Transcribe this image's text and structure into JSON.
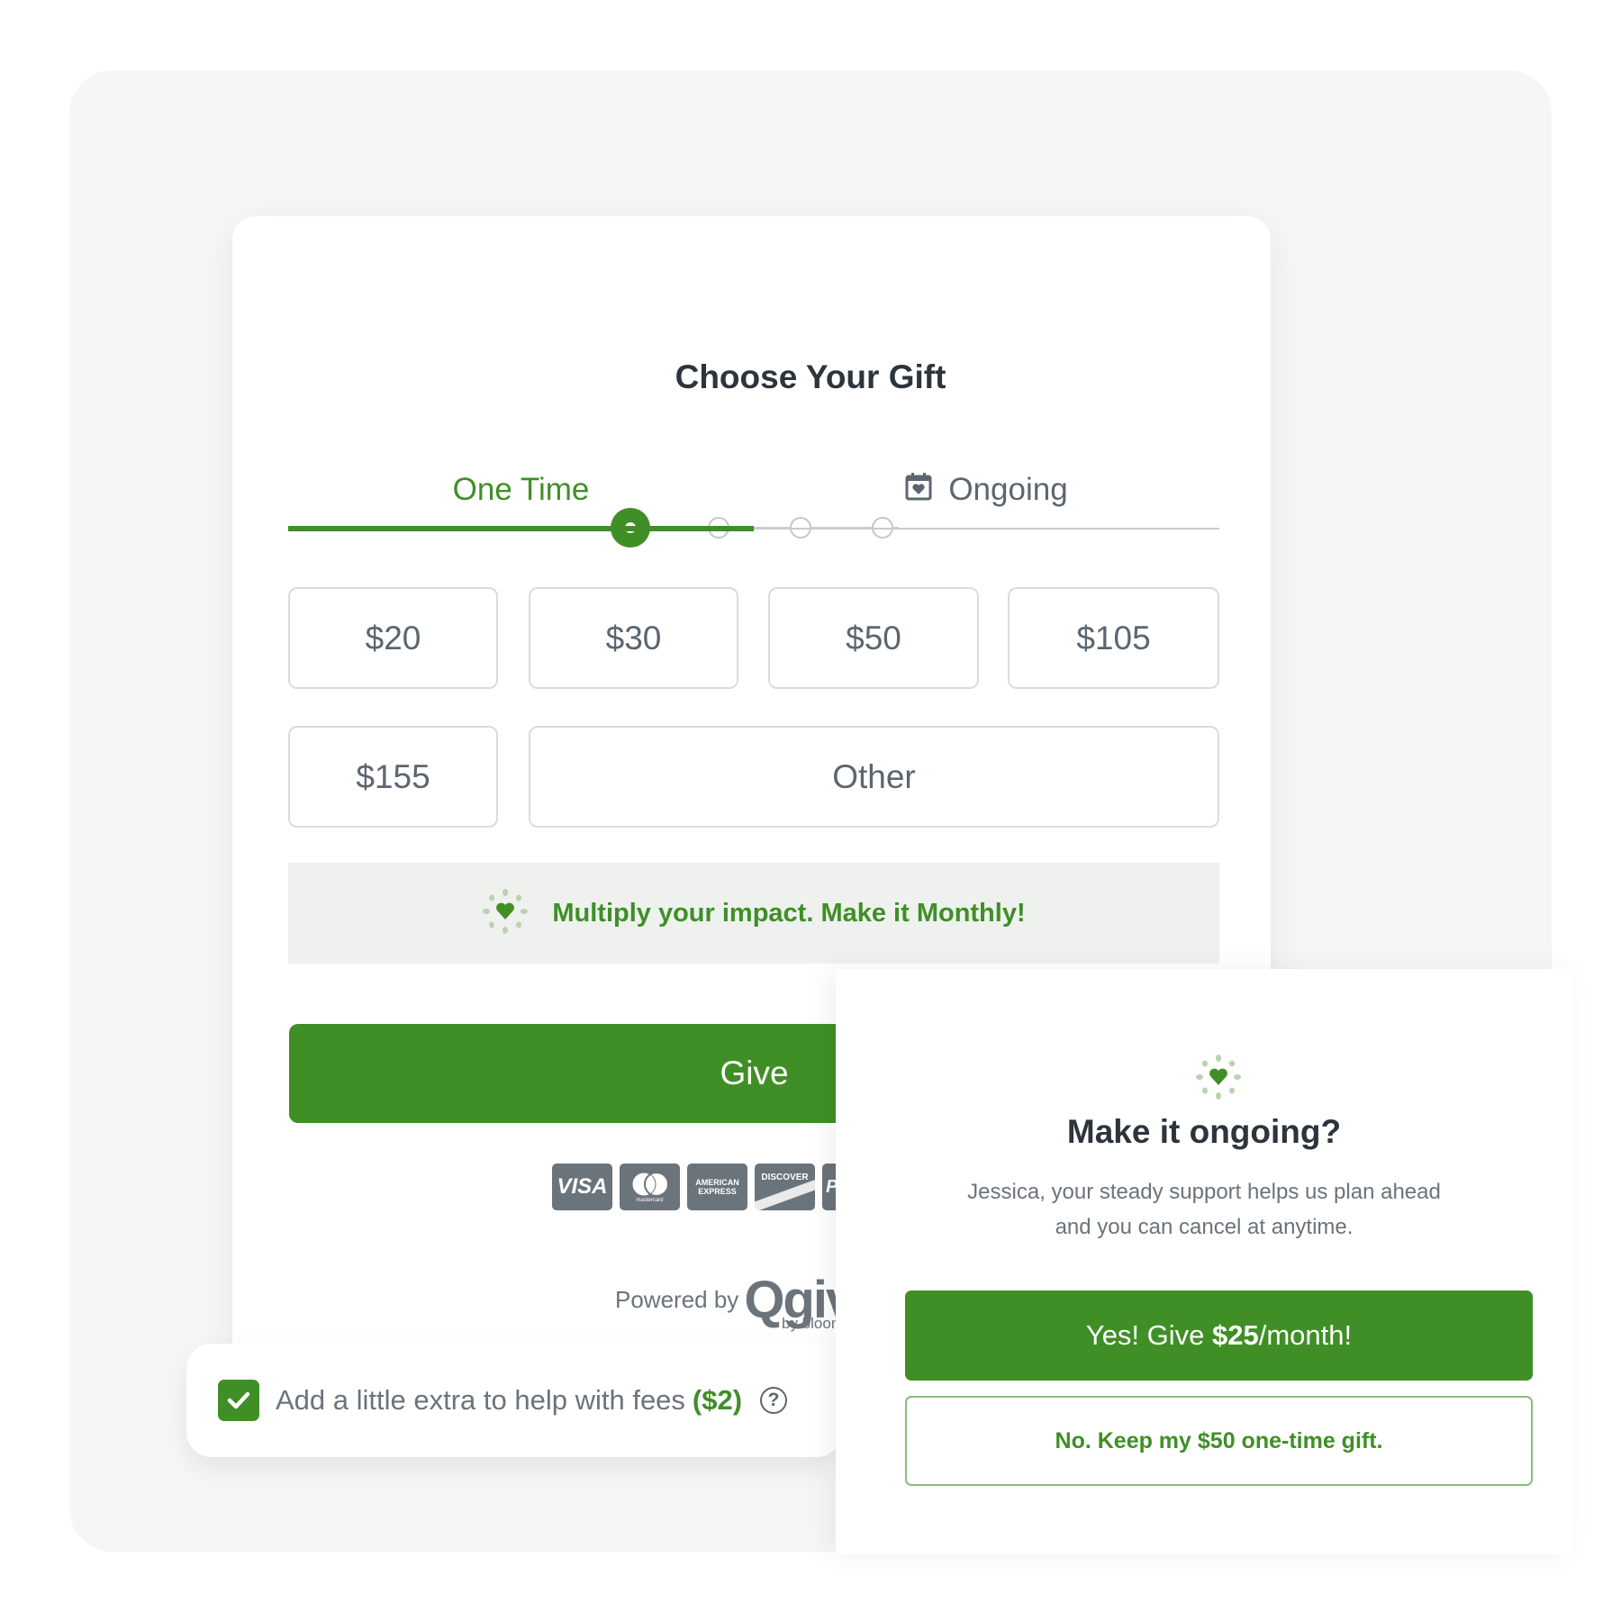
{
  "colors": {
    "accent": "#3f8f26",
    "text_dark": "#2d343b",
    "text_muted": "#6b737b",
    "banner_bg": "#eef1ee"
  },
  "stepper": {
    "total_steps": 4,
    "current_step": 1
  },
  "form": {
    "title": "Choose Your Gift",
    "tabs": [
      {
        "label": "One Time",
        "active": true
      },
      {
        "label": "Ongoing",
        "active": false,
        "icon": "calendar-heart-icon"
      }
    ],
    "amounts": [
      "$20",
      "$30",
      "$50",
      "$105",
      "$155"
    ],
    "other_label": "Other",
    "banner_text": "Multiply your impact. Make it Monthly!",
    "give_label": "Give",
    "payment_cards": [
      "VISA",
      "mastercard",
      "AMERICAN EXPRESS",
      "DISCOVER",
      "PayPal"
    ],
    "powered_by": "Powered by",
    "brand": "Qgiv",
    "brand_sub": "by bloom"
  },
  "fee": {
    "checked": true,
    "label": "Add a little extra to help with fees",
    "amount": "($2)"
  },
  "popup": {
    "title": "Make it ongoing?",
    "message_line1": "Jessica, your steady support helps us plan ahead",
    "message_line2": "and you can cancel at anytime.",
    "yes_prefix": "Yes! Give ",
    "yes_amount": "$25",
    "yes_suffix": "/month!",
    "no_label": "No. Keep my $50 one-time gift."
  }
}
